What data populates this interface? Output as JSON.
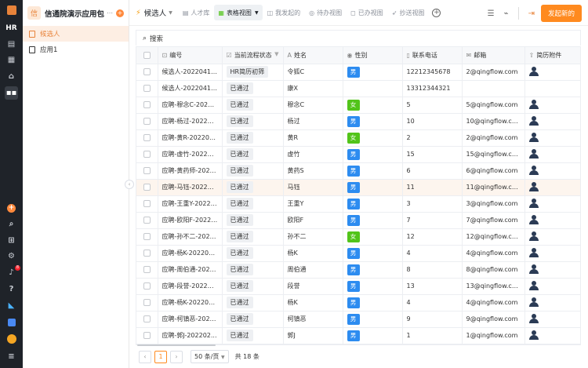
{
  "rail": {
    "hr_label": "HR",
    "badge_count": "8"
  },
  "app": {
    "logo_char": "信",
    "title": "信通院演示应用包",
    "items": [
      {
        "label": "候选人"
      },
      {
        "label": "应用1"
      }
    ]
  },
  "topbar": {
    "form_name": "候选人",
    "tabs": [
      {
        "label": "人才库"
      },
      {
        "label": "表格视图"
      },
      {
        "label": "我发起的"
      },
      {
        "label": "待办视图"
      },
      {
        "label": "已办视图"
      },
      {
        "label": "抄送视图"
      }
    ],
    "primary_button": "发起新的"
  },
  "search": {
    "label": "搜索"
  },
  "table": {
    "columns": [
      "编号",
      "当前流程状态",
      "姓名",
      "性别",
      "联系电话",
      "邮箱",
      "简历附件"
    ],
    "rows": [
      {
        "id": "候选人-20220414...",
        "status": "HR简历初筛",
        "name": "令狐C",
        "gender": "男",
        "phone": "12212345678",
        "email": "2@qingflow.com",
        "resume": true
      },
      {
        "id": "候选人-20220414...",
        "status": "已通过",
        "name": "康X",
        "gender": "",
        "phone": "13312344321",
        "email": "",
        "resume": false
      },
      {
        "id": "应聘-穆念C-2022...",
        "status": "已通过",
        "name": "穆念C",
        "gender": "女",
        "phone": "5",
        "email": "5@qingflow.com",
        "resume": true
      },
      {
        "id": "应聘-杨过-202202...",
        "status": "已通过",
        "name": "杨过",
        "gender": "男",
        "phone": "10",
        "email": "10@qingflow.com",
        "resume": true
      },
      {
        "id": "应聘-黄R-202202...",
        "status": "已通过",
        "name": "黄R",
        "gender": "女",
        "phone": "2",
        "email": "2@qingflow.com",
        "resume": true
      },
      {
        "id": "应聘-虚竹-202202...",
        "status": "已通过",
        "name": "虚竹",
        "gender": "男",
        "phone": "15",
        "email": "15@qingflow.com",
        "resume": true
      },
      {
        "id": "应聘-黄药师-2022...",
        "status": "已通过",
        "name": "黄药S",
        "gender": "男",
        "phone": "6",
        "email": "6@qingflow.com",
        "resume": true
      },
      {
        "id": "应聘-马钰-202202...",
        "status": "已通过",
        "name": "马钰",
        "gender": "男",
        "phone": "11",
        "email": "11@qingflow.com",
        "resume": true
      },
      {
        "id": "应聘-王重Y-20220...",
        "status": "已通过",
        "name": "王重Y",
        "gender": "男",
        "phone": "3",
        "email": "3@qingflow.com",
        "resume": true
      },
      {
        "id": "应聘-欧阳F-20220...",
        "status": "已通过",
        "name": "欧阳F",
        "gender": "男",
        "phone": "7",
        "email": "7@qingflow.com",
        "resume": true
      },
      {
        "id": "应聘-孙不二-2022...",
        "status": "已通过",
        "name": "孙不二",
        "gender": "女",
        "phone": "12",
        "email": "12@qingflow.com",
        "resume": true
      },
      {
        "id": "应聘-杨K-202202...",
        "status": "已通过",
        "name": "杨K",
        "gender": "男",
        "phone": "4",
        "email": "4@qingflow.com",
        "resume": true
      },
      {
        "id": "应聘-周伯通-2022...",
        "status": "已通过",
        "name": "周伯通",
        "gender": "男",
        "phone": "8",
        "email": "8@qingflow.com",
        "resume": true
      },
      {
        "id": "应聘-段誉-202202...",
        "status": "已通过",
        "name": "段誉",
        "gender": "男",
        "phone": "13",
        "email": "13@qingflow.com",
        "resume": true
      },
      {
        "id": "应聘-杨K-202202...",
        "status": "已通过",
        "name": "杨K",
        "gender": "男",
        "phone": "4",
        "email": "4@qingflow.com",
        "resume": true
      },
      {
        "id": "应聘-柯镇恶-2022...",
        "status": "已通过",
        "name": "柯镇恶",
        "gender": "男",
        "phone": "9",
        "email": "9@qingflow.com",
        "resume": true
      },
      {
        "id": "应聘-郭J-202202...",
        "status": "已通过",
        "name": "郭J",
        "gender": "男",
        "phone": "1",
        "email": "1@qingflow.com",
        "resume": true
      }
    ]
  },
  "pagination": {
    "current": "1",
    "page_size": "50 条/页",
    "total": "共 18 条"
  },
  "colors": {
    "accent": "#ff8a1f",
    "male": "#2d8cf0",
    "female": "#52c41a"
  }
}
